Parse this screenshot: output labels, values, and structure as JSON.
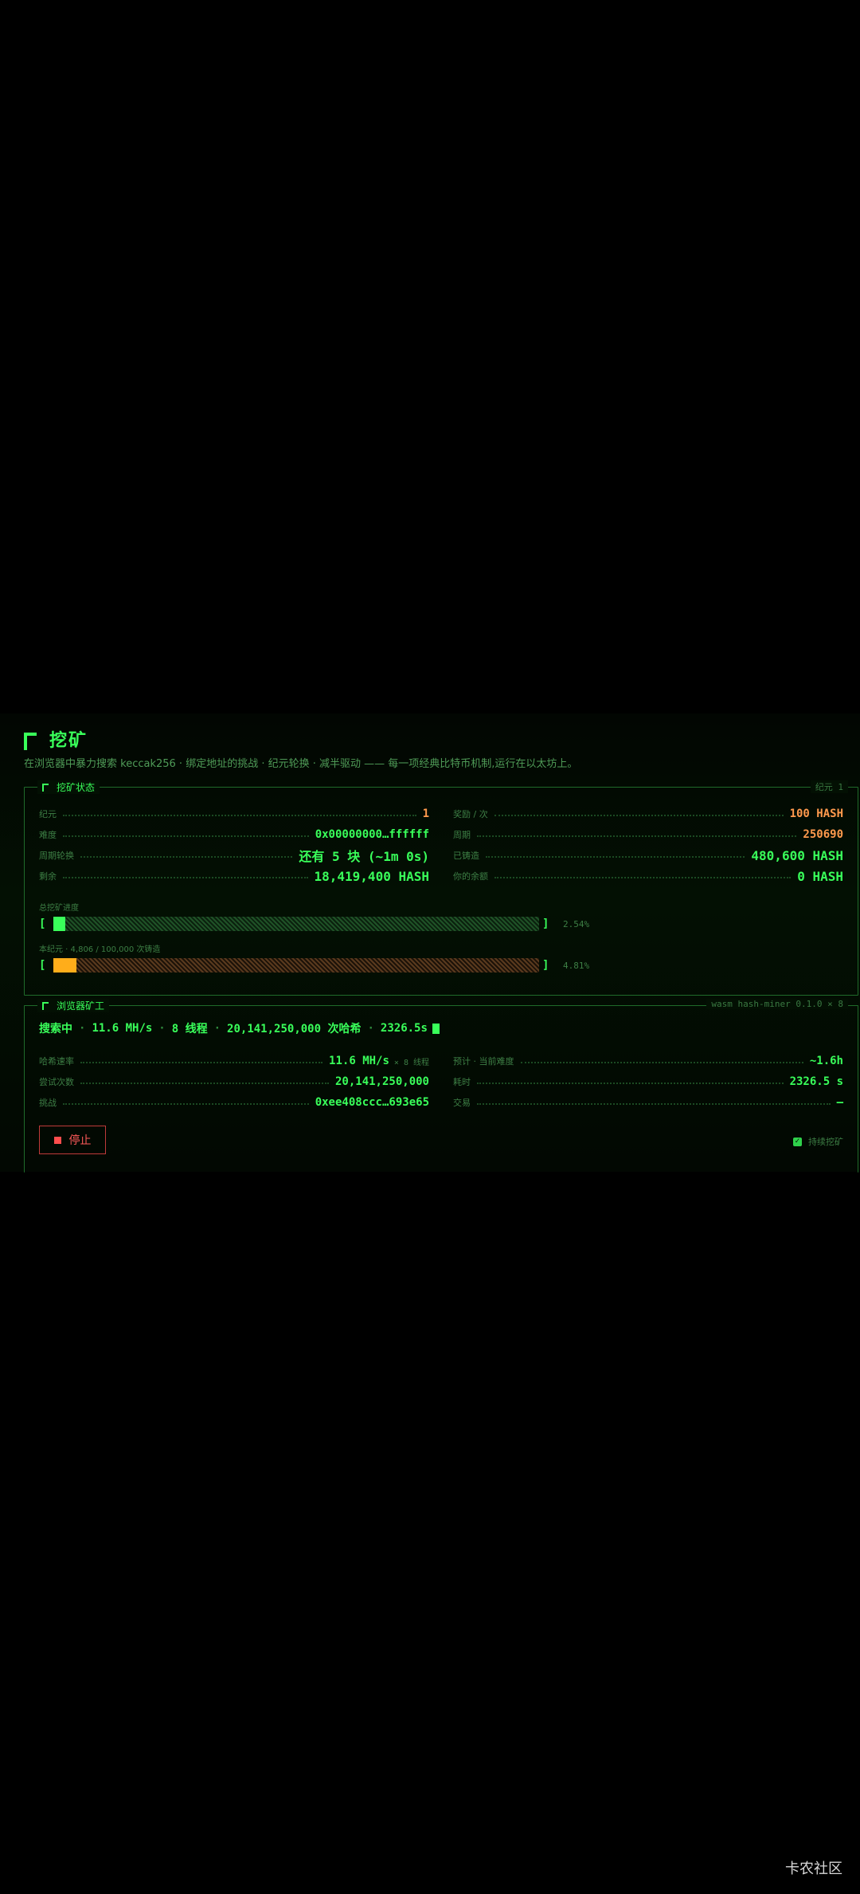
{
  "header": {
    "title": "挖矿",
    "subtitle": "在浏览器中暴力搜索 keccak256 · 绑定地址的挑战 · 纪元轮换 · 减半驱动 —— 每一项经典比特币机制,运行在以太坊上。"
  },
  "status_panel": {
    "label": "挖矿状态",
    "tag": "纪元 1",
    "left_rows": [
      {
        "label": "纪元",
        "value": "1"
      },
      {
        "label": "难度",
        "value": "0x00000000…ffffff"
      },
      {
        "label": "周期轮换",
        "value": "还有 5 块 (~1m 0s)"
      },
      {
        "label": "剩余",
        "value": "18,419,400 HASH"
      }
    ],
    "right_rows": [
      {
        "label": "奖励 / 次",
        "value": "100 HASH"
      },
      {
        "label": "周期",
        "value": "250690"
      },
      {
        "label": "已铸造",
        "value": "480,600 HASH"
      },
      {
        "label": "你的余额",
        "value": "0 HASH"
      }
    ],
    "total_progress": {
      "label": "总挖矿进度",
      "percent_text": "2.54%",
      "fraction": 0.0254
    },
    "epoch_progress": {
      "label": "本纪元 · 4,806 / 100,000 次铸造",
      "percent_text": "4.81%",
      "fraction": 0.0481
    }
  },
  "worker_panel": {
    "label": "浏览器矿工",
    "tag": "wasm hash-miner 0.1.0 × 8",
    "status_line": {
      "state": "搜索中",
      "rate": "11.6 MH/s",
      "threads": "8 线程",
      "hashes": "20,141,250,000 次哈希",
      "elapsed": "2326.5s"
    },
    "left_rows": [
      {
        "label": "哈希速率",
        "value": "11.6 MH/s",
        "sub": "× 8 线程"
      },
      {
        "label": "尝试次数",
        "value": "20,141,250,000"
      },
      {
        "label": "挑战",
        "value": "0xee408ccc…693e65"
      }
    ],
    "right_rows": [
      {
        "label": "预计 · 当前难度",
        "value": "~1.6h"
      },
      {
        "label": "耗时",
        "value": "2326.5 s"
      },
      {
        "label": "交易",
        "value": "—"
      }
    ],
    "stop_label": "停止",
    "continuous_label": "持续挖矿",
    "continuous_checked": true
  },
  "watermark": "卡农社区",
  "colors": {
    "accent": "#39ff5a",
    "orange": "#ff9a4d",
    "bar_orange": "#ffad1a",
    "stop_red": "#ff5a5a",
    "background": "#000000"
  }
}
